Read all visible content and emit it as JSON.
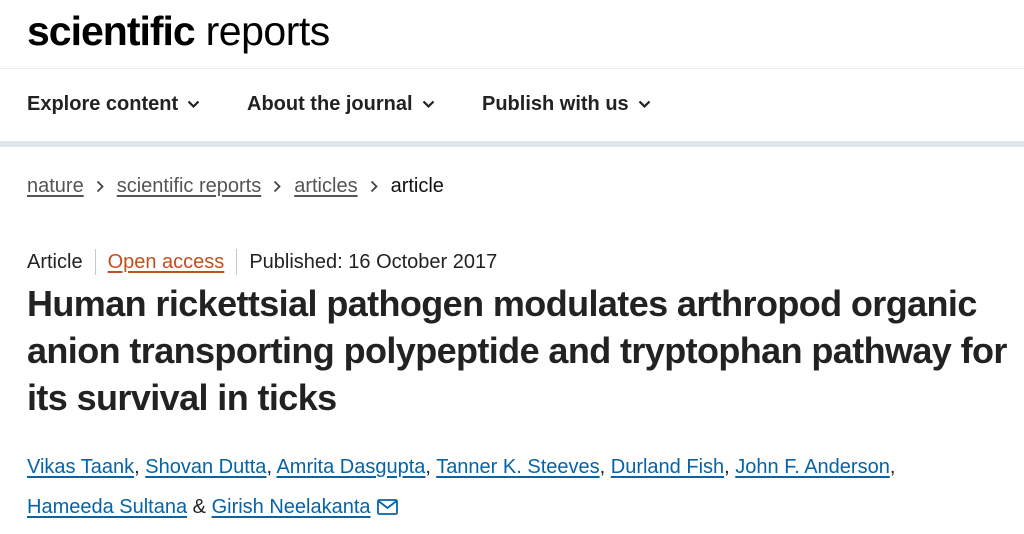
{
  "site": {
    "logo_bold": "scientific",
    "logo_light": "reports"
  },
  "nav": {
    "items": [
      {
        "label": "Explore content",
        "icon": "chevron-down-icon"
      },
      {
        "label": "About the journal",
        "icon": "chevron-down-icon"
      },
      {
        "label": "Publish with us",
        "icon": "chevron-down-icon"
      }
    ]
  },
  "breadcrumb": {
    "items": [
      "nature",
      "scientific reports",
      "articles"
    ],
    "current": "article",
    "separator_icon": "chevron-right-icon"
  },
  "article": {
    "type": "Article",
    "access": "Open access",
    "published": "Published: 16 October 2017",
    "title": "Human rickettsial pathogen modulates arthropod organic anion transporting polypeptide and tryptophan pathway for its survival in ticks",
    "authors": [
      "Vikas Taank",
      "Shovan Dutta",
      "Amrita Dasgupta",
      "Tanner K. Steeves",
      "Durland Fish",
      "John F. Anderson",
      "Hameeda Sultana",
      "Girish Neelakanta"
    ],
    "comma": ",",
    "ampersand": "&",
    "corresponding_icon": "envelope-icon"
  },
  "colors": {
    "author_link": "#0563a8",
    "open_access": "#c0501d",
    "nav_border": "#dfe6ed"
  }
}
